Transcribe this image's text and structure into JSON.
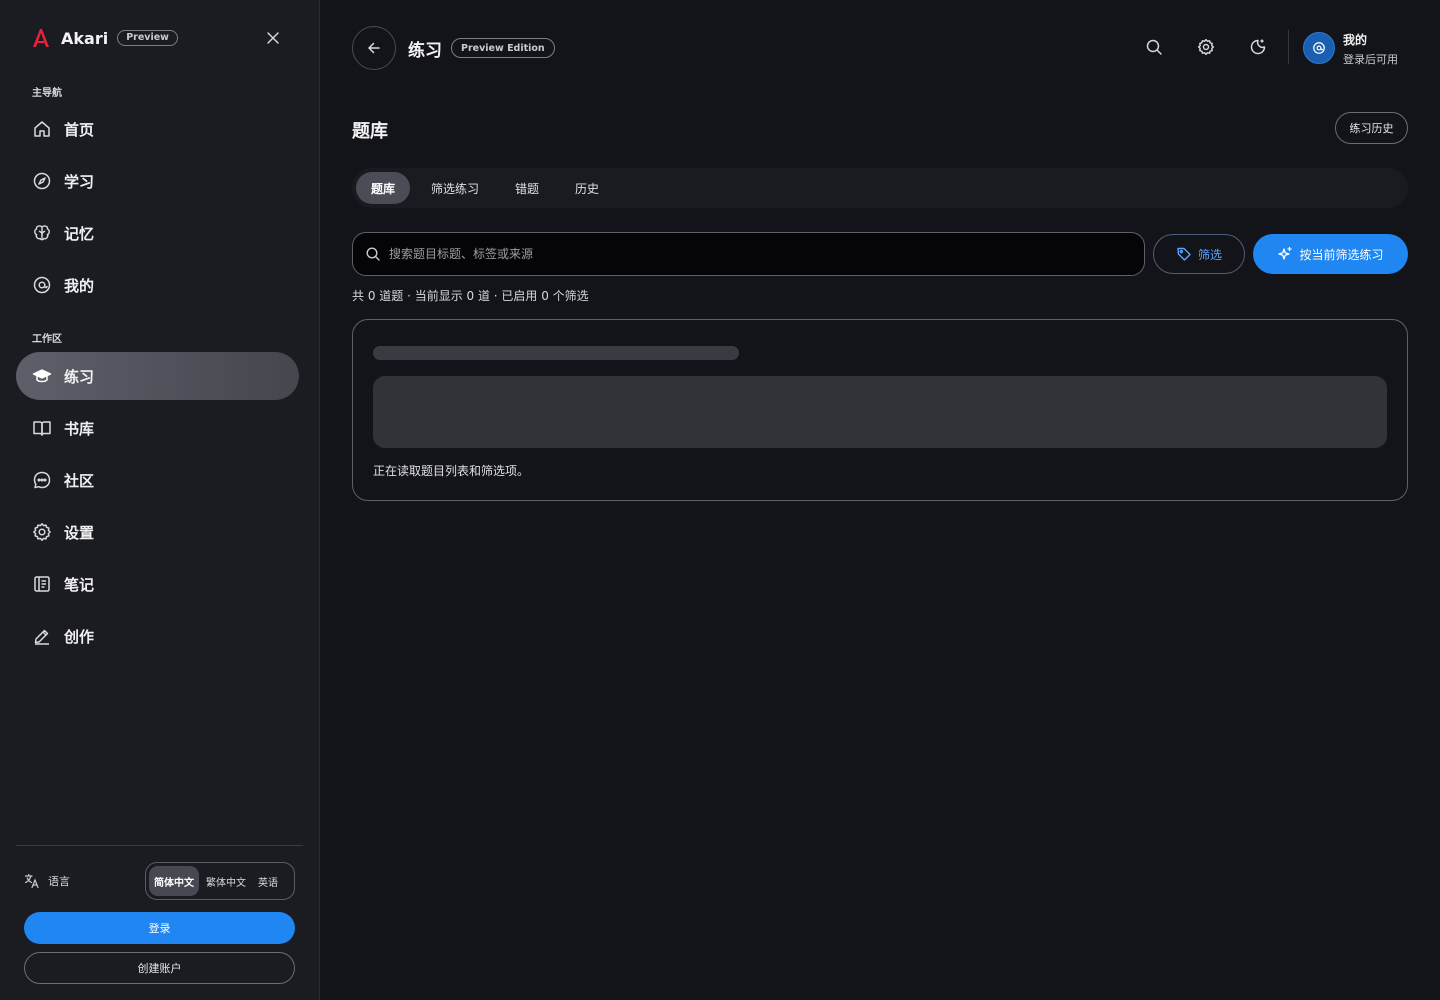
{
  "brand": {
    "name": "Akari",
    "badge": "Preview"
  },
  "sidebar": {
    "section_main": "主导航",
    "section_workspace": "工作区",
    "main_items": [
      {
        "label": "首页",
        "icon": "home-icon"
      },
      {
        "label": "学习",
        "icon": "compass-icon"
      },
      {
        "label": "记忆",
        "icon": "brain-icon"
      },
      {
        "label": "我的",
        "icon": "user-circle-icon"
      }
    ],
    "work_items": [
      {
        "label": "练习",
        "icon": "graduation-cap-icon",
        "active": true
      },
      {
        "label": "书库",
        "icon": "book-open-icon"
      },
      {
        "label": "社区",
        "icon": "chat-bubble-icon"
      },
      {
        "label": "设置",
        "icon": "gear-icon"
      },
      {
        "label": "笔记",
        "icon": "notebook-icon"
      },
      {
        "label": "创作",
        "icon": "pen-icon"
      }
    ],
    "language": {
      "label": "语言",
      "options": [
        "简体中文",
        "繁体中文",
        "英语"
      ],
      "selected": "简体中文"
    },
    "login_label": "登录",
    "signup_label": "创建账户"
  },
  "header": {
    "title": "练习",
    "badge": "Preview Edition",
    "user_name": "我的",
    "user_sub": "登录后可用"
  },
  "main": {
    "title": "题库",
    "history_button": "练习历史",
    "tabs": [
      {
        "label": "题库",
        "active": true
      },
      {
        "label": "筛选练习"
      },
      {
        "label": "错题"
      },
      {
        "label": "历史"
      }
    ],
    "search_placeholder": "搜索题目标题、标签或来源",
    "filter_label": "筛选",
    "practice_label": "按当前筛选练习",
    "stats": "共 0 道题 · 当前显示 0 道 · 已启用 0 个筛选",
    "loading_text": "正在读取题目列表和筛选项。"
  },
  "colors": {
    "accent": "#1f86f2",
    "logo": "#e5243b",
    "background": "#131419",
    "sidebar": "#1b1c22"
  }
}
